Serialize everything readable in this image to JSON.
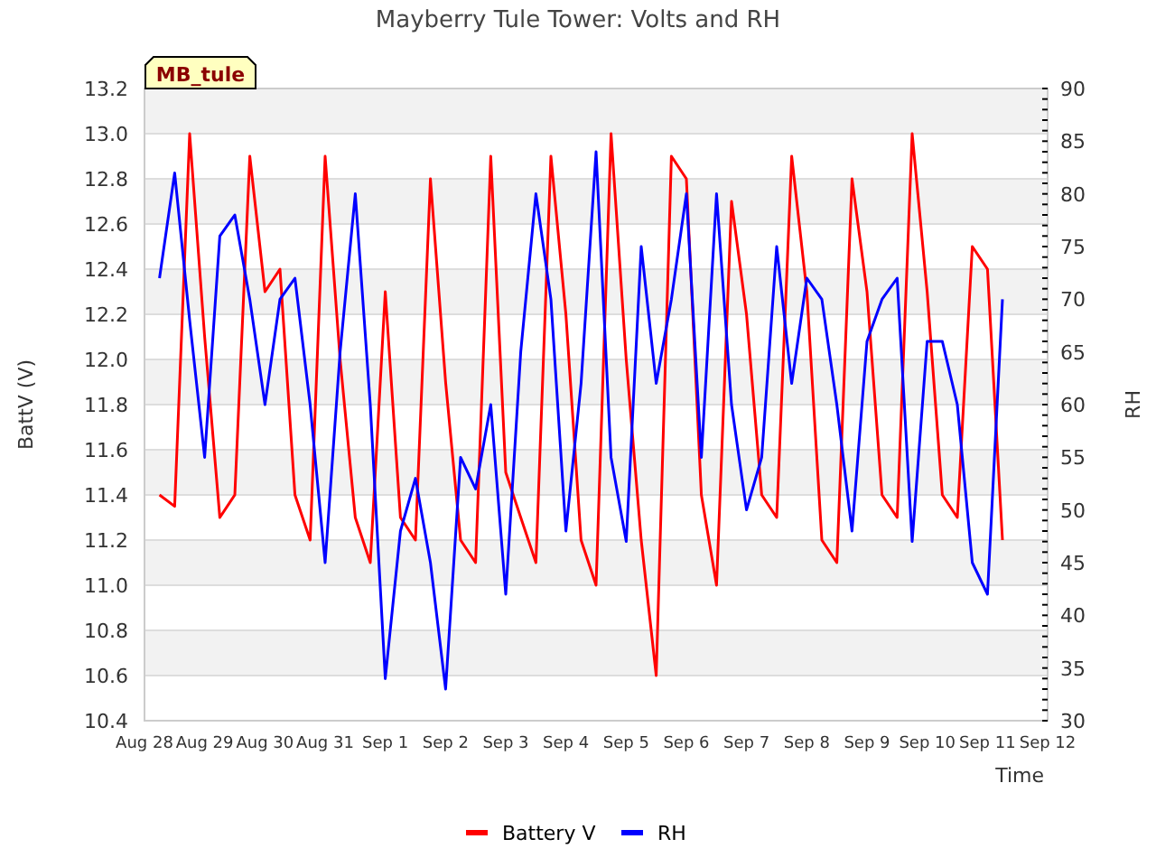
{
  "chart": {
    "title": "Mayberry Tule Tower: Volts and RH",
    "station_tag": "MB_tule",
    "chart_data": {
      "type": "line",
      "grid": true,
      "legend": true,
      "xlabel": "Time",
      "ylabel": "BattV (V)",
      "y2label": "RH",
      "ylim": [
        10.4,
        13.2
      ],
      "y2lim": [
        30,
        90
      ],
      "categories": [
        "Aug 28",
        null,
        null,
        null,
        "Aug 29",
        null,
        null,
        null,
        "Aug 30",
        null,
        null,
        null,
        "Aug 31",
        null,
        null,
        null,
        "Sep 1",
        null,
        null,
        null,
        "Sep 2",
        null,
        null,
        null,
        "Sep 3",
        null,
        null,
        null,
        "Sep 4",
        null,
        null,
        null,
        "Sep 5",
        null,
        null,
        null,
        "Sep 6",
        null,
        null,
        null,
        "Sep 7",
        null,
        null,
        null,
        "Sep 8",
        null,
        null,
        null,
        "Sep 9",
        null,
        null,
        null,
        "Sep 10",
        null,
        null,
        null,
        "Sep 11",
        null,
        null,
        null,
        "Sep 12"
      ],
      "yticks": [
        {
          "value": 10.4,
          "label": "10.4"
        },
        {
          "value": 10.6,
          "label": "10.6"
        },
        {
          "value": 10.8,
          "label": "10.8"
        },
        {
          "value": 11.0,
          "label": "11.0"
        },
        {
          "value": 11.2,
          "label": "11.2"
        },
        {
          "value": 11.4,
          "label": "11.4"
        },
        {
          "value": 11.6,
          "label": "11.6"
        },
        {
          "value": 11.8,
          "label": "11.8"
        },
        {
          "value": 12.0,
          "label": "12.0"
        },
        {
          "value": 12.2,
          "label": "12.2"
        },
        {
          "value": 12.4,
          "label": "12.4"
        },
        {
          "value": 12.6,
          "label": "12.6"
        },
        {
          "value": 12.8,
          "label": "12.8"
        },
        {
          "value": 13.0,
          "label": "13.0"
        },
        {
          "value": 13.2,
          "label": "13.2"
        }
      ],
      "y2ticks": [
        30,
        35,
        40,
        45,
        50,
        55,
        60,
        65,
        70,
        75,
        80,
        85,
        90
      ],
      "series": [
        {
          "name": "Battery V",
          "color": "#ff0000",
          "values": [
            null,
            11.4,
            11.35,
            13.0,
            12.1,
            11.3,
            11.4,
            12.9,
            12.3,
            12.4,
            11.4,
            11.2,
            12.9,
            12.0,
            11.3,
            11.1,
            12.3,
            11.3,
            11.2,
            12.8,
            11.9,
            11.2,
            11.1,
            12.9,
            11.5,
            11.3,
            11.1,
            12.9,
            12.2,
            11.2,
            11.0,
            13.0,
            12.0,
            11.2,
            10.6,
            12.9,
            12.8,
            11.4,
            11.0,
            12.7,
            12.2,
            11.4,
            11.3,
            12.9,
            12.3,
            11.2,
            11.1,
            12.8,
            12.3,
            11.4,
            11.3,
            13.0,
            12.3,
            11.4,
            11.3,
            12.5,
            12.4,
            11.2,
            null,
            null,
            null
          ]
        },
        {
          "name": "RH",
          "color": "#0000ff",
          "axis": "y2",
          "values": [
            null,
            72,
            82,
            68,
            55,
            76,
            78,
            70,
            60,
            70,
            72,
            60,
            45,
            65,
            80,
            60,
            34,
            48,
            53,
            45,
            33,
            55,
            52,
            60,
            42,
            65,
            80,
            70,
            48,
            62,
            84,
            55,
            47,
            75,
            62,
            70,
            80,
            55,
            80,
            60,
            50,
            55,
            75,
            62,
            72,
            70,
            60,
            48,
            66,
            70,
            72,
            47,
            66,
            66,
            60,
            45,
            42,
            70,
            null,
            null,
            null
          ]
        }
      ]
    }
  }
}
